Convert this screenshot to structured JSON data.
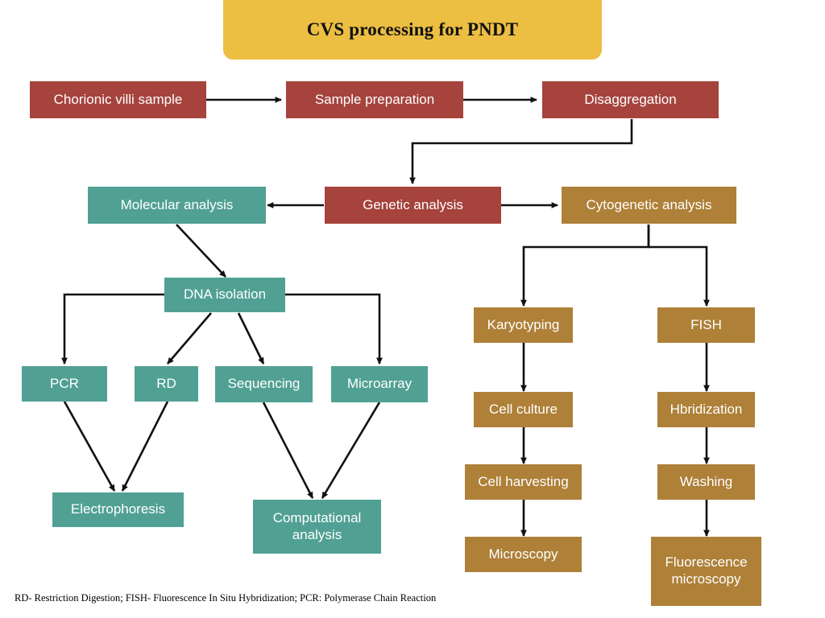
{
  "title": {
    "text": "CVS processing for PNDT",
    "background": "#ecbe42"
  },
  "colors": {
    "red": "#a5433c",
    "teal": "#51a094",
    "brown": "#ae8038",
    "yellow": "#ecbe42",
    "node_text": "#ffffff",
    "edge": "#111111"
  },
  "nodes": {
    "chorionic_villi_sample": "Chorionic villi sample",
    "sample_preparation": "Sample preparation",
    "disaggregation": "Disaggregation",
    "molecular_analysis": "Molecular analysis",
    "genetic_analysis": "Genetic analysis",
    "cytogenetic_analysis": "Cytogenetic analysis",
    "dna_isolation": "DNA isolation",
    "pcr": "PCR",
    "rd": "RD",
    "sequencing": "Sequencing",
    "microarray": "Microarray",
    "electrophoresis": "Electrophoresis",
    "computational_analysis": "Computational analysis",
    "karyotyping": "Karyotyping",
    "cell_culture": "Cell culture",
    "cell_harvesting": "Cell harvesting",
    "microscopy": "Microscopy",
    "fish": "FISH",
    "hbridization": "Hbridization",
    "washing": "Washing",
    "fluorescence_microscopy": "Fluorescence microscopy"
  },
  "footnote": {
    "text": "RD- Restriction Digestion; FISH- Fluorescence In Situ Hybridization; PCR: Polymerase Chain Reaction"
  }
}
